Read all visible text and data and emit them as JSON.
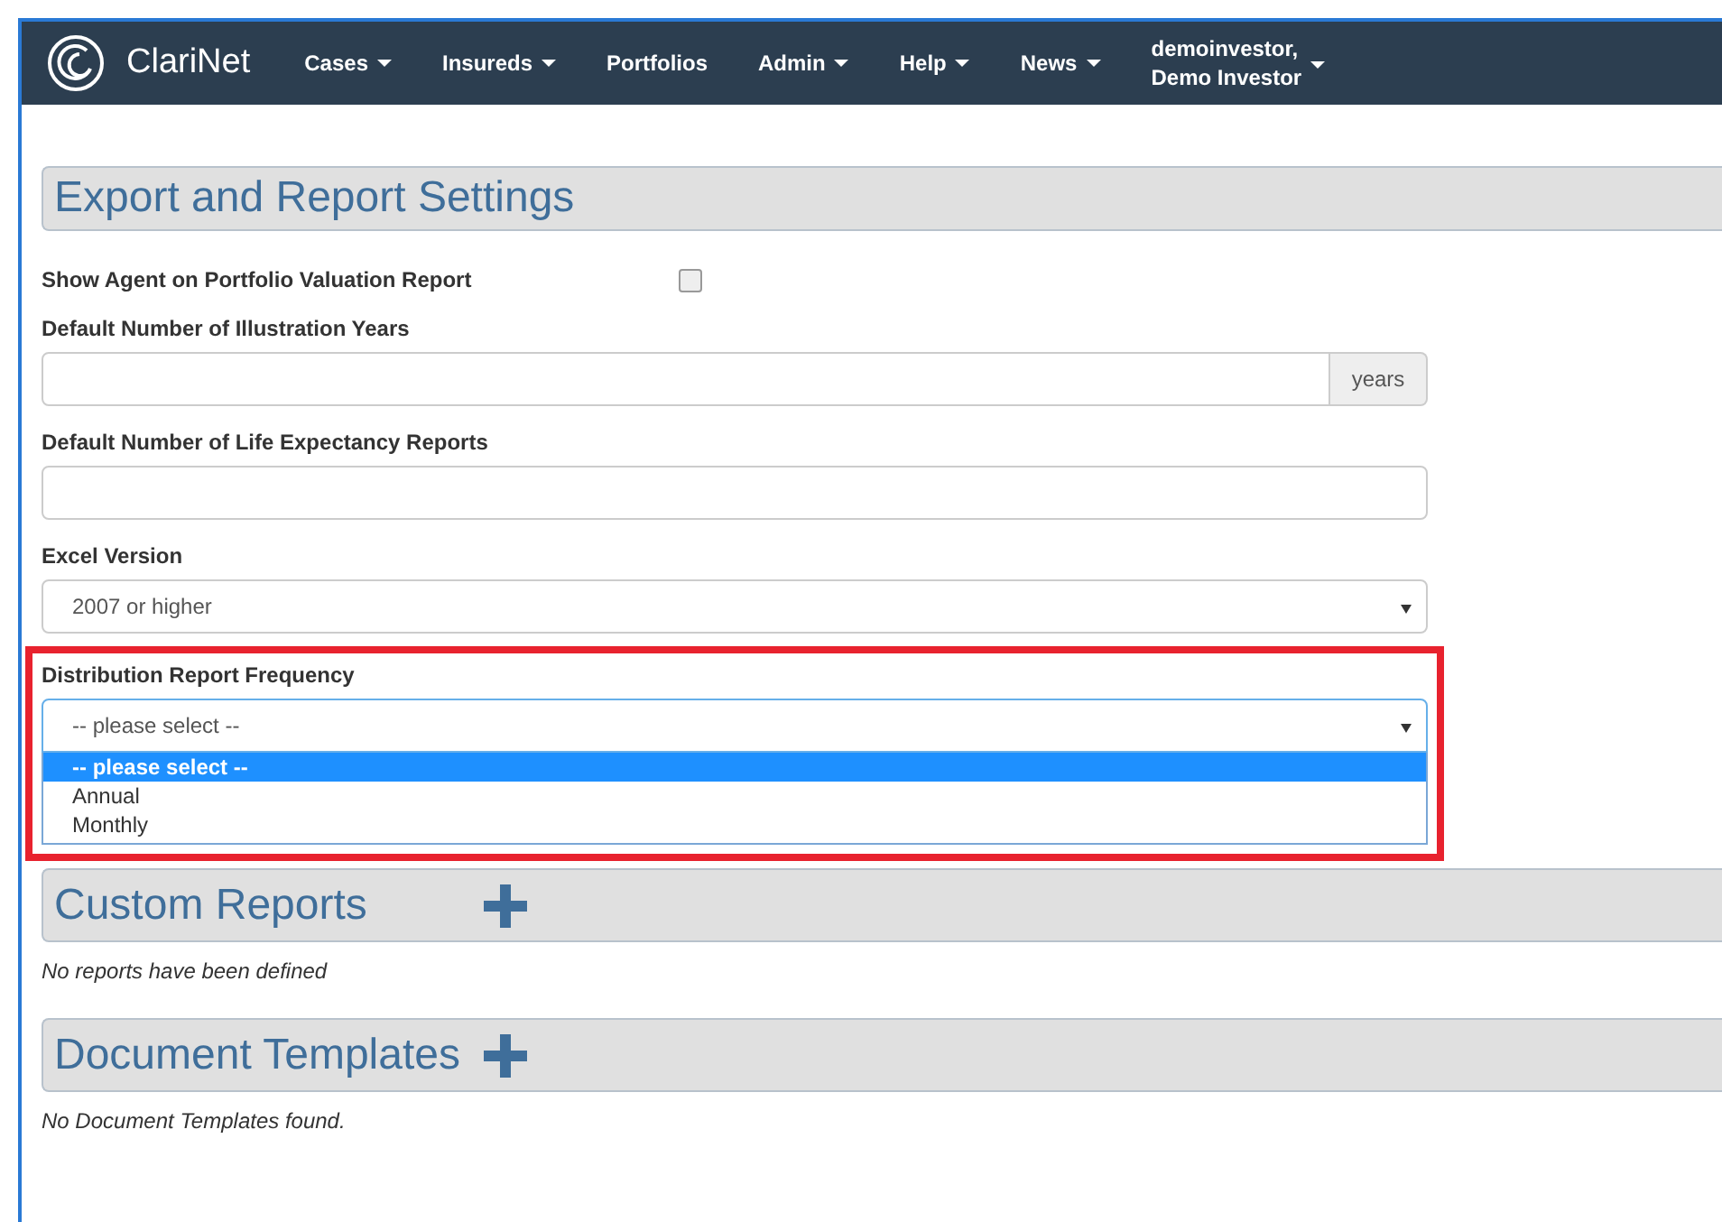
{
  "navbar": {
    "brand": "ClariNet",
    "items": [
      {
        "label": "Cases",
        "dropdown": true
      },
      {
        "label": "Insureds",
        "dropdown": true
      },
      {
        "label": "Portfolios",
        "dropdown": false
      },
      {
        "label": "Admin",
        "dropdown": true
      },
      {
        "label": "Help",
        "dropdown": true
      },
      {
        "label": "News",
        "dropdown": true
      }
    ],
    "user": {
      "line_1": "demoinvestor,",
      "line_2": "Demo Investor",
      "dropdown": true
    }
  },
  "settings": {
    "title": "Export and Report Settings",
    "fields": [
      {
        "kind": "checkbox",
        "label": "Show Agent on Portfolio Valuation Report",
        "checked": false
      },
      {
        "kind": "addon-input",
        "label": "Default Number of Illustration Years",
        "addon": "years"
      },
      {
        "kind": "input",
        "label": "Default Number of Life Expectancy Reports"
      },
      {
        "kind": "select",
        "label": "Excel Version",
        "value": "2007 or higher"
      },
      {
        "kind": "open-select",
        "label": "Distribution Report Frequency",
        "value": "-- please select --",
        "highlighted": true,
        "options": [
          {
            "label": "-- please select --",
            "selected": true
          },
          {
            "label": "Annual",
            "selected": false
          },
          {
            "label": "Monthly",
            "selected": false
          }
        ]
      }
    ]
  },
  "sections": [
    {
      "title": "Custom Reports",
      "note": "No reports have been defined"
    },
    {
      "title": "Document Templates",
      "note": "No Document Templates found."
    }
  ]
}
